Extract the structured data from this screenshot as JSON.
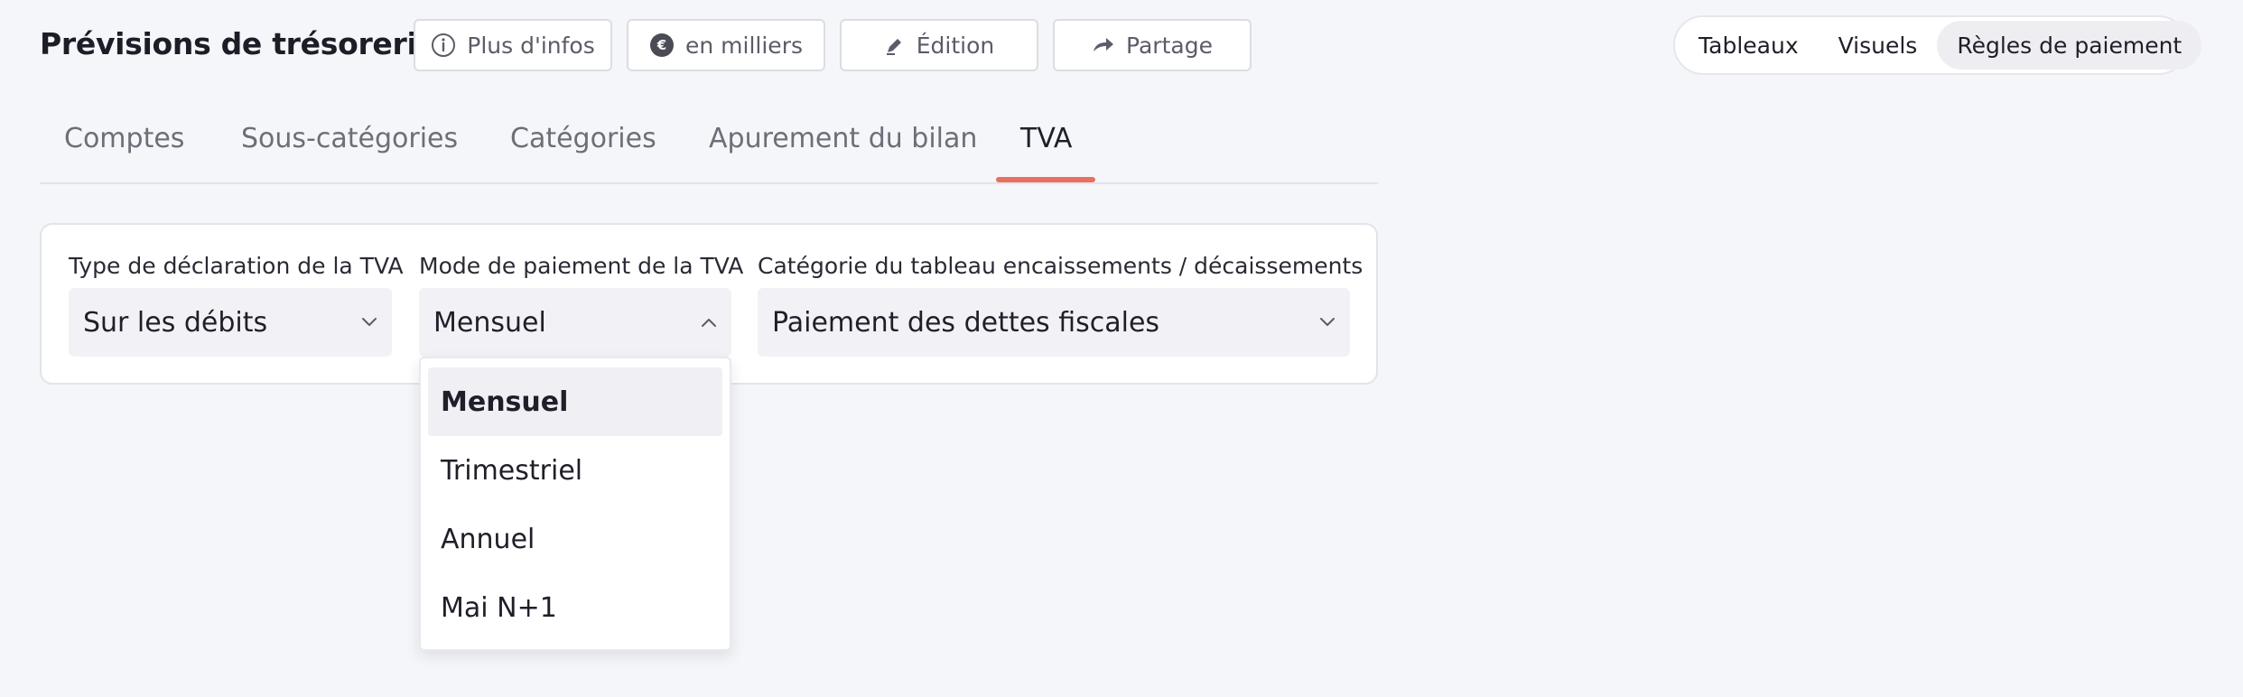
{
  "header": {
    "title": "Prévisions de trésorerie",
    "buttons": {
      "info": {
        "label": "Plus d'infos",
        "icon": "info-icon"
      },
      "units": {
        "label": "en milliers",
        "icon": "euro-icon"
      },
      "edit": {
        "label": "Édition",
        "icon": "pen-icon"
      },
      "share": {
        "label": "Partage",
        "icon": "share-icon"
      }
    },
    "view_switch": {
      "options": [
        "Tableaux",
        "Visuels",
        "Règles de paiement"
      ],
      "selected": "Règles de paiement"
    }
  },
  "tabs": {
    "items": [
      "Comptes",
      "Sous-catégories",
      "Catégories",
      "Apurement du bilan",
      "TVA"
    ],
    "active": "TVA"
  },
  "form": {
    "type_label": "Type de déclaration de la TVA",
    "type_value": "Sur les débits",
    "mode_label": "Mode de paiement de la TVA",
    "mode_value": "Mensuel",
    "category_label": "Catégorie du tableau encaissements / décaissements",
    "category_value": "Paiement des dettes fiscales"
  },
  "dropdown": {
    "options": [
      "Mensuel",
      "Trimestriel",
      "Annuel",
      "Mai N+1"
    ],
    "selected": "Mensuel"
  },
  "colors": {
    "accent": "#e8705f",
    "background": "#f5f6f9",
    "surface": "#ffffff",
    "select_bg": "#f2f2f6"
  }
}
